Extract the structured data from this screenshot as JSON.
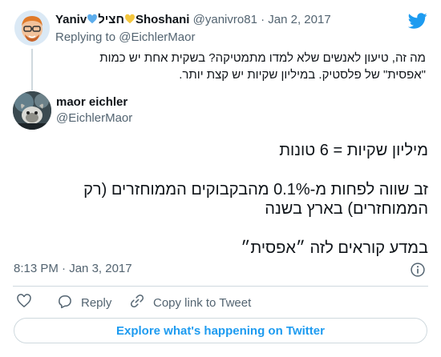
{
  "parent_tweet": {
    "name_part1": "Yaniv",
    "name_hebrew": "חציל",
    "name_part2": "Shoshani",
    "handle": "@yanivro81",
    "separator": "·",
    "date": "Jan 2, 2017",
    "replying_prefix": "Replying to",
    "replying_handle": "@EichlerMaor",
    "text": "מה זה, טיעון לאנשים שלא למדו מתמטיקה? בשקית אחת יש כמות \"אפסית\" של פלסטיק. במיליון שקיות יש קצת יותר."
  },
  "main_tweet": {
    "name": "maor eichler",
    "handle": "@EichlerMaor",
    "lines": [
      "מיליון שקיות = 6 טונות",
      "זב שווה לפחות מ-0.1% מהבקבוקים הממוחזרים (רק הממוחזרים) בארץ בשנה",
      "במדע קוראים לזה ״אפסית״"
    ],
    "time": "8:13 PM",
    "separator": "·",
    "date": "Jan 3, 2017"
  },
  "actions": {
    "reply": "Reply",
    "copy_link": "Copy link to Tweet"
  },
  "explore_button": "Explore what's happening on Twitter",
  "icons": {
    "brand": "twitter-bird-icon",
    "info": "info-icon",
    "like": "heart-outline-icon",
    "reply": "speech-bubble-icon",
    "copy": "link-icon"
  },
  "colors": {
    "accent": "#1d9bf0",
    "text": "#0f1419",
    "muted": "#536471",
    "border": "#cfd9de",
    "blue_heart": "#5dadec",
    "yellow_heart": "#f4c63d"
  }
}
